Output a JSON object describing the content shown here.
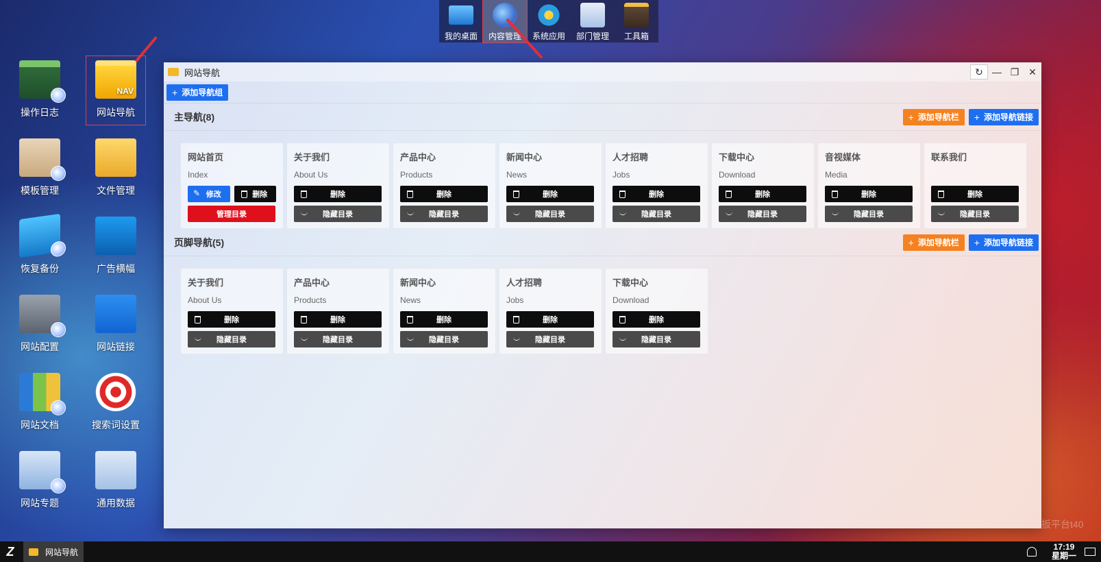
{
  "dock": {
    "items": [
      {
        "label": "我的桌面",
        "icon": "monitor-icon"
      },
      {
        "label": "内容管理",
        "icon": "globe-icon"
      },
      {
        "label": "系统应用",
        "icon": "gear-icon"
      },
      {
        "label": "部门管理",
        "icon": "id-card-icon"
      },
      {
        "label": "工具箱",
        "icon": "toolbox-icon"
      }
    ]
  },
  "desktop": {
    "icons": [
      {
        "label": "操作日志",
        "icon": "log-folder-icon"
      },
      {
        "label": "网站导航",
        "icon": "nav-folder-icon"
      },
      {
        "label": "模板管理",
        "icon": "template-icon"
      },
      {
        "label": "文件管理",
        "icon": "file-folder-icon"
      },
      {
        "label": "恢复备份",
        "icon": "backup-icon"
      },
      {
        "label": "广告横幅",
        "icon": "banner-icon"
      },
      {
        "label": "网站配置",
        "icon": "server-icon"
      },
      {
        "label": "网站链接",
        "icon": "link-icon"
      },
      {
        "label": "网站文档",
        "icon": "binders-icon"
      },
      {
        "label": "搜索词设置",
        "icon": "target-icon"
      },
      {
        "label": "网站专题",
        "icon": "special-icon"
      },
      {
        "label": "通用数据",
        "icon": "data-icon"
      }
    ],
    "nav_badge": "NAV"
  },
  "window": {
    "title": "网站导航",
    "controls": {
      "refresh": "↻",
      "minimize": "—",
      "restore": "❐",
      "close": "✕"
    },
    "add_group_label": "添加导航组",
    "add_bar_label": "添加导航栏",
    "add_link_label": "添加导航链接",
    "main_nav": {
      "title": "主导航(8)",
      "cards": [
        {
          "name": "网站首页",
          "en": "Index"
        },
        {
          "name": "关于我们",
          "en": "About Us"
        },
        {
          "name": "产品中心",
          "en": "Products"
        },
        {
          "name": "新闻中心",
          "en": "News"
        },
        {
          "name": "人才招聘",
          "en": "Jobs"
        },
        {
          "name": "下载中心",
          "en": "Download"
        },
        {
          "name": "音视媒体",
          "en": "Media"
        },
        {
          "name": "联系我们",
          "en": ""
        }
      ]
    },
    "footer_nav": {
      "title": "页脚导航(5)",
      "cards": [
        {
          "name": "关于我们",
          "en": "About Us"
        },
        {
          "name": "产品中心",
          "en": "Products"
        },
        {
          "name": "新闻中心",
          "en": "News"
        },
        {
          "name": "人才招聘",
          "en": "Jobs"
        },
        {
          "name": "下载中心",
          "en": "Download"
        }
      ]
    },
    "buttons": {
      "edit": "修改",
      "delete": "删除",
      "manage_dir": "管理目录",
      "hide_dir": "隐藏目录"
    }
  },
  "watermark": "扳平台t40",
  "taskbar": {
    "start_label": "Z",
    "task_label": "网站导航",
    "time": "17:19",
    "weekday": "星期一"
  },
  "colors": {
    "primary_blue": "#1e6ff0",
    "orange": "#f58220",
    "danger_red": "#e00f1c"
  }
}
